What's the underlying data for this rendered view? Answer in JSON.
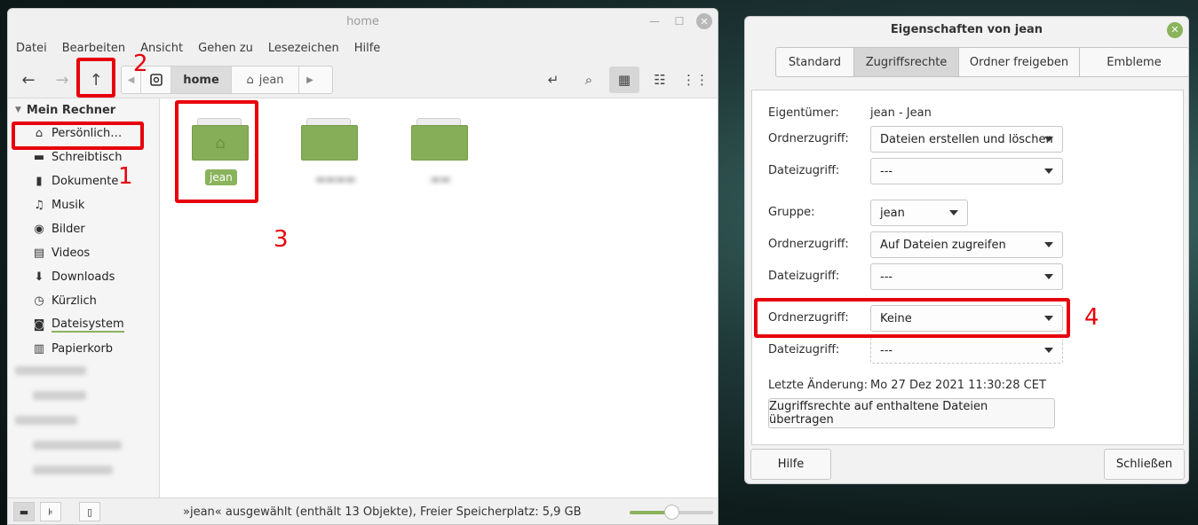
{
  "file_manager": {
    "title": "home",
    "menu": [
      "Datei",
      "Bearbeiten",
      "Ansicht",
      "Gehen zu",
      "Lesezeichen",
      "Hilfe"
    ],
    "pathbar": {
      "home_label": "home",
      "jean_label": "jean"
    },
    "sidebar": {
      "section_title": "Mein Rechner",
      "items": [
        {
          "label": "Persönlich…",
          "icon": "home-icon"
        },
        {
          "label": "Schreibtisch",
          "icon": "desktop-icon"
        },
        {
          "label": "Dokumente",
          "icon": "document-icon"
        },
        {
          "label": "Musik",
          "icon": "music-icon"
        },
        {
          "label": "Bilder",
          "icon": "camera-icon"
        },
        {
          "label": "Videos",
          "icon": "film-icon"
        },
        {
          "label": "Downloads",
          "icon": "download-icon"
        },
        {
          "label": "Kürzlich",
          "icon": "history-icon"
        },
        {
          "label": "Dateisystem",
          "icon": "drive-icon"
        },
        {
          "label": "Papierkorb",
          "icon": "trash-icon"
        }
      ]
    },
    "folders": [
      {
        "label": "jean",
        "selected": true
      },
      {
        "label": "",
        "selected": false
      },
      {
        "label": "",
        "selected": false
      }
    ],
    "status": "»jean« ausgewählt (enthält 13 Objekte), Freier Speicherplatz: 5,9 GB",
    "zoom_level": 0.5
  },
  "dialog": {
    "title": "Eigenschaften von jean",
    "tabs": [
      "Standard",
      "Zugriffsrechte",
      "Ordner freigeben",
      "Embleme"
    ],
    "active_tab": "Zugriffsrechte",
    "owner_label": "Eigentümer:",
    "owner_value": "jean - Jean",
    "owner_folder_label": "Ordnerzugriff:",
    "owner_folder_value": "Dateien erstellen und löschen",
    "owner_file_label": "Dateizugriff:",
    "owner_file_value": "---",
    "group_label": "Gruppe:",
    "group_value": "jean",
    "group_folder_label": "Ordnerzugriff:",
    "group_folder_value": "Auf Dateien zugreifen",
    "group_file_label": "Dateizugriff:",
    "group_file_value": "---",
    "other_folder_label": "Ordnerzugriff:",
    "other_folder_value": "Keine",
    "other_file_label": "Dateizugriff:",
    "other_file_value": "---",
    "modified_label": "Letzte Änderung:",
    "modified_value": "Mo 27 Dez 2021 11:30:28 CET",
    "apply_button": "Zugriffsrechte auf enthaltene Dateien übertragen",
    "help_button": "Hilfe",
    "close_button": "Schließen"
  },
  "annotations": {
    "colors": {
      "highlight": "#e8000b",
      "accent": "#8ab35c"
    },
    "step1": "1",
    "step2": "2",
    "step3": "3",
    "step4": "4"
  }
}
